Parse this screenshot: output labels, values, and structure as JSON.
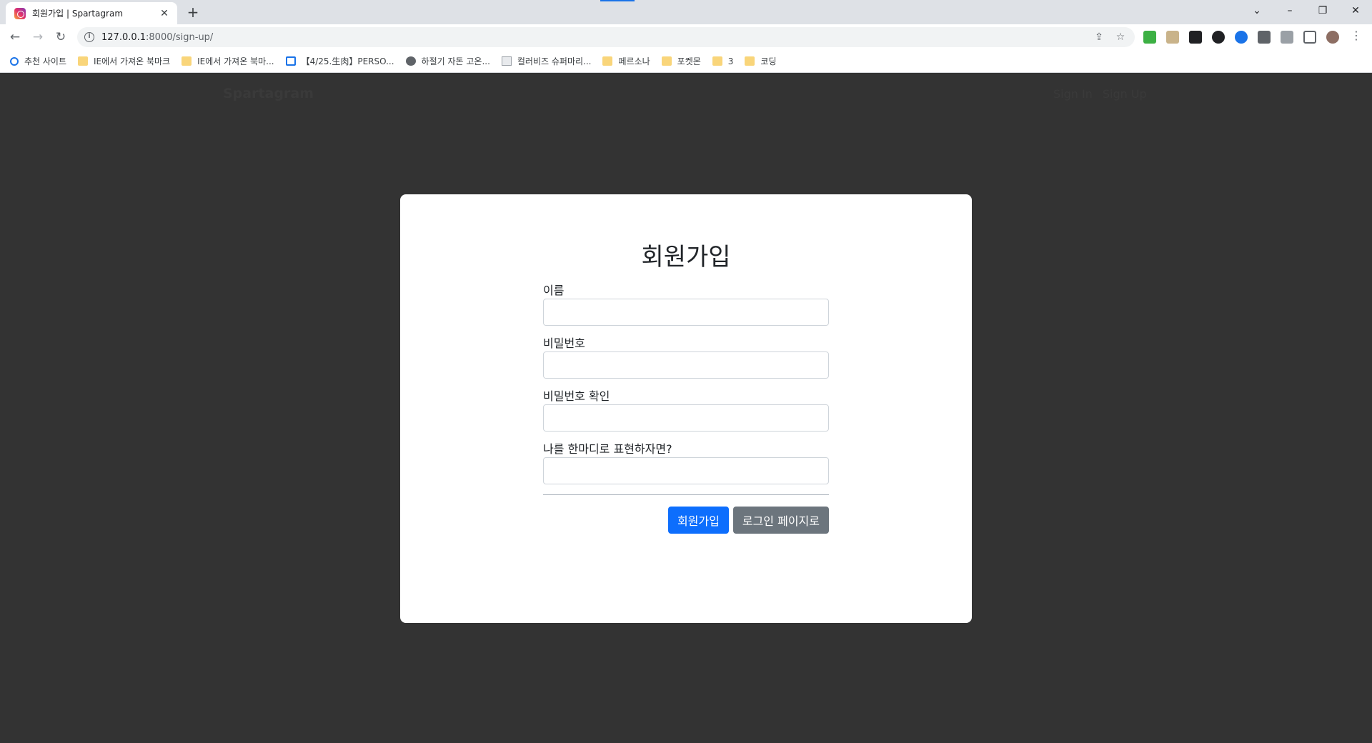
{
  "browser": {
    "tab": {
      "title": "회원가입 | Spartagram",
      "close_glyph": "✕"
    },
    "new_tab_glyph": "+",
    "window_controls": {
      "dropdown": "⌄",
      "minimize": "–",
      "restore": "❐",
      "close": "✕"
    },
    "nav": {
      "back": "←",
      "forward": "→",
      "reload": "↻"
    },
    "address": {
      "host": "127.0.0.1",
      "path": ":8000/sign-up/"
    },
    "bookmarks": [
      {
        "label": "추천 사이트",
        "icon": "search-icon"
      },
      {
        "label": "IE에서 가져온 북마크",
        "icon": "folder-icon"
      },
      {
        "label": "IE에서 가져온 북마...",
        "icon": "folder-icon"
      },
      {
        "label": "【4/25.生肉】PERSO...",
        "icon": "calendar-icon"
      },
      {
        "label": "하절기 자돈 고온...",
        "icon": "globe-icon"
      },
      {
        "label": "컬러비즈 슈퍼마리...",
        "icon": "broken-image-icon"
      },
      {
        "label": "페르소나",
        "icon": "folder-icon"
      },
      {
        "label": "포켓몬",
        "icon": "folder-icon"
      },
      {
        "label": "3",
        "icon": "folder-icon"
      },
      {
        "label": "코딩",
        "icon": "folder-icon"
      }
    ]
  },
  "site": {
    "brand": "Spartagram",
    "nav": {
      "sign_in": "Sign In",
      "sign_up": "Sign Up"
    }
  },
  "form": {
    "title": "회원가입",
    "fields": {
      "name": {
        "label": "이름",
        "value": ""
      },
      "password": {
        "label": "비밀번호",
        "value": ""
      },
      "password_confirm": {
        "label": "비밀번호 확인",
        "value": ""
      },
      "bio": {
        "label": "나를 한마디로 표현하자면?",
        "value": ""
      }
    },
    "submit_label": "회원가입",
    "login_label": "로그인 페이지로"
  },
  "colors": {
    "primary": "#0d6efd",
    "secondary": "#6c757d",
    "backdrop": "#333333"
  }
}
